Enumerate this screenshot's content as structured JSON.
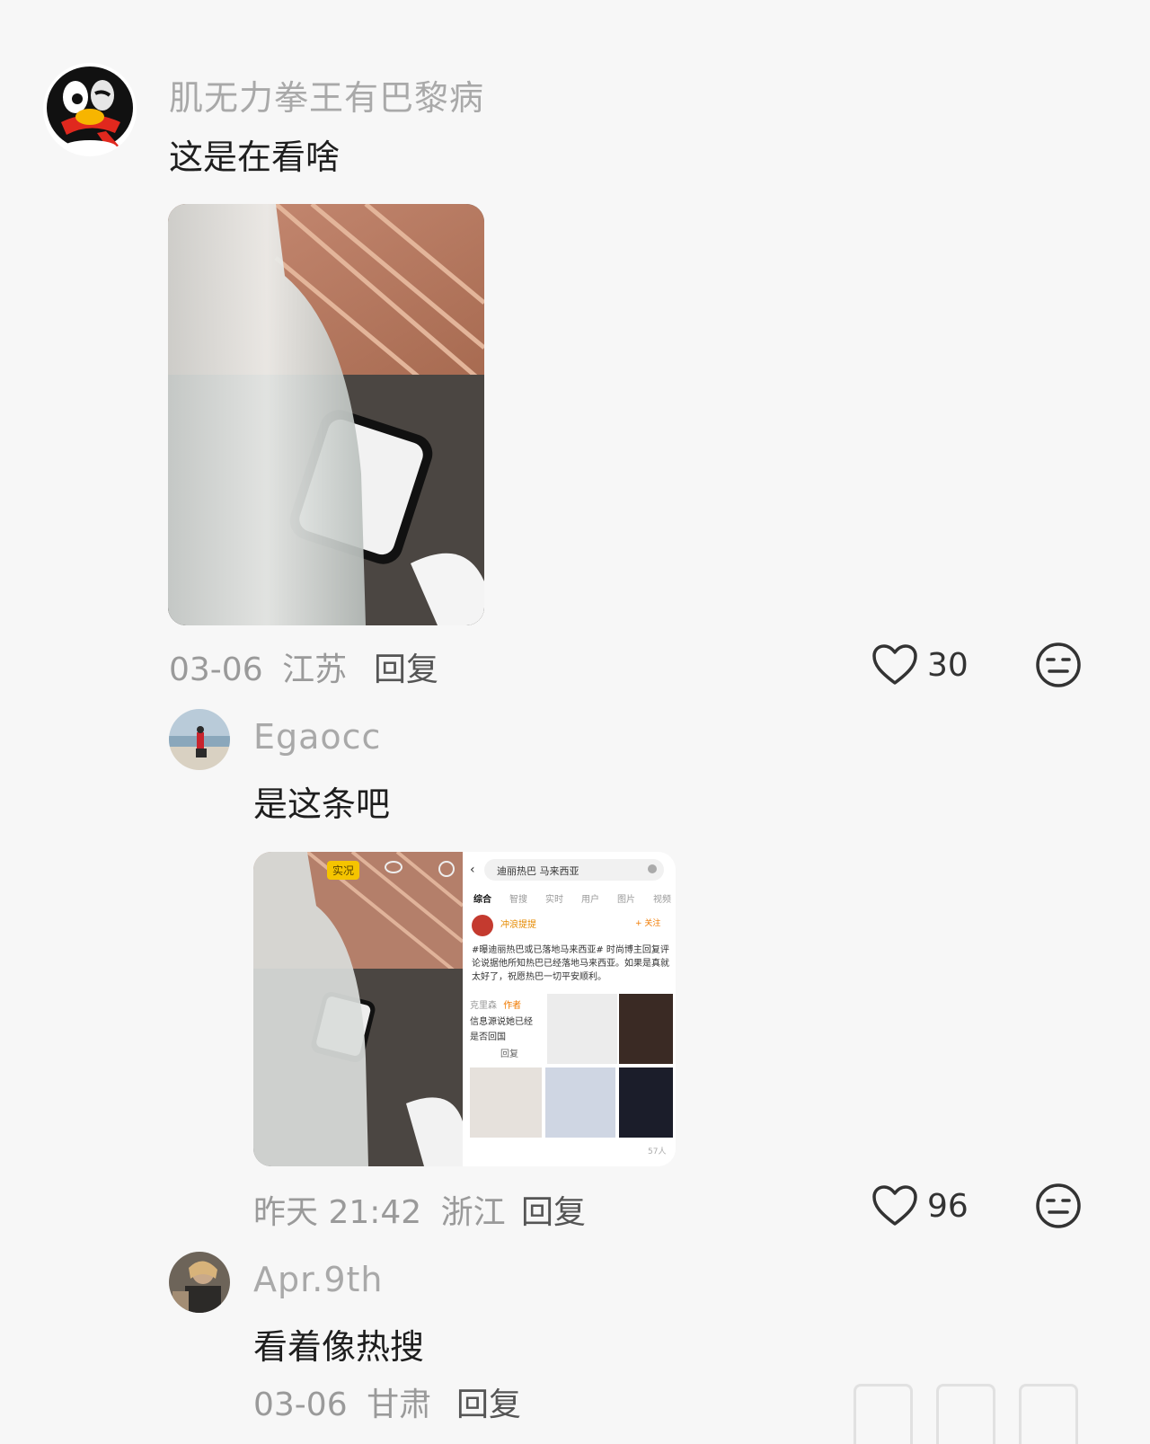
{
  "comments": [
    {
      "username": "肌无力拳王有巴黎病",
      "text": "这是在看啥",
      "time": "03-06",
      "location": "江苏",
      "reply_label": "回复",
      "likes": "30",
      "avatar_icon": "qq-penguin-icon"
    },
    {
      "username": "Egaocc",
      "text": "是这条吧",
      "time": "昨天 21:42",
      "location": "浙江",
      "reply_label": "回复",
      "likes": "96",
      "avatar_icon": "beach-photo-avatar",
      "screenshot": {
        "live_badge": "实况",
        "search_query": "迪丽热巴 马来西亚",
        "tabs": [
          "综合",
          "智搜",
          "实时",
          "用户",
          "图片",
          "视频"
        ],
        "author": "冲浪提提",
        "follow_label": "+ 关注",
        "post_text": "#曝迪丽热巴或已落地马来西亚# 时尚博主回复评论说据他所知热巴已经落地马来西亚。如果是真就太好了，祝愿热巴一切平安顺利。",
        "side_lines": [
          "信息源说她已经",
          "是否回国"
        ],
        "side_author": "克里森",
        "side_badge": "作者",
        "side_reply": "回复",
        "views": "57人"
      }
    },
    {
      "username": "Apr.9th",
      "text": "看着像热搜",
      "time": "03-06",
      "location": "甘肃",
      "reply_label": "回复",
      "avatar_icon": "person-photo-avatar"
    }
  ]
}
